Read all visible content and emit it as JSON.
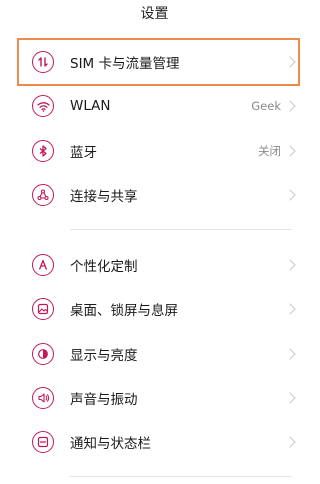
{
  "title": "设置",
  "sections": [
    {
      "items": [
        {
          "label": "SIM 卡与流量管理",
          "value": "",
          "icon": "sim-data-icon"
        },
        {
          "label": "WLAN",
          "value": "Geek",
          "icon": "wifi-icon"
        },
        {
          "label": "蓝牙",
          "value": "关闭",
          "icon": "bluetooth-icon"
        },
        {
          "label": "连接与共享",
          "value": "",
          "icon": "share-icon"
        }
      ]
    },
    {
      "items": [
        {
          "label": "个性化定制",
          "value": "",
          "icon": "personalize-icon"
        },
        {
          "label": "桌面、锁屏与息屏",
          "value": "",
          "icon": "wallpaper-icon"
        },
        {
          "label": "显示与亮度",
          "value": "",
          "icon": "display-icon"
        },
        {
          "label": "声音与振动",
          "value": "",
          "icon": "sound-icon"
        },
        {
          "label": "通知与状态栏",
          "value": "",
          "icon": "notification-icon"
        }
      ]
    }
  ],
  "colors": {
    "accent": "#c2185b",
    "highlight": "#f08a4b",
    "chevron": "#c8c8c8",
    "value_text": "#8a8a8a"
  }
}
